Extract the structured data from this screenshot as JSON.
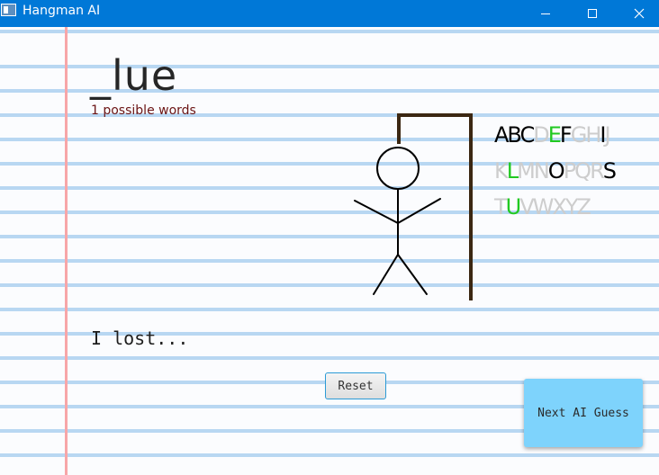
{
  "window": {
    "title": "Hangman AI",
    "controls": {
      "minimize": "—",
      "maximize": "☐",
      "close": "✕"
    }
  },
  "game": {
    "word_display": "_lue",
    "possible_words": "1 possible words",
    "status": "I lost...",
    "wrong_guesses_shown": 6
  },
  "alphabet": {
    "rows": [
      [
        {
          "ch": "A",
          "state": "used"
        },
        {
          "ch": "B",
          "state": "used"
        },
        {
          "ch": "C",
          "state": "used"
        },
        {
          "ch": "D",
          "state": "avail"
        },
        {
          "ch": "E",
          "state": "hit"
        },
        {
          "ch": "F",
          "state": "used"
        },
        {
          "ch": "G",
          "state": "avail"
        },
        {
          "ch": "H",
          "state": "avail"
        },
        {
          "ch": "I",
          "state": "used"
        },
        {
          "ch": "J",
          "state": "avail"
        }
      ],
      [
        {
          "ch": "K",
          "state": "avail"
        },
        {
          "ch": "L",
          "state": "hit"
        },
        {
          "ch": "M",
          "state": "avail"
        },
        {
          "ch": "N",
          "state": "avail"
        },
        {
          "ch": "O",
          "state": "used"
        },
        {
          "ch": "P",
          "state": "avail"
        },
        {
          "ch": "Q",
          "state": "avail"
        },
        {
          "ch": "R",
          "state": "avail"
        },
        {
          "ch": "S",
          "state": "used"
        }
      ],
      [
        {
          "ch": "T",
          "state": "avail"
        },
        {
          "ch": "U",
          "state": "hit"
        },
        {
          "ch": "V",
          "state": "avail"
        },
        {
          "ch": "W",
          "state": "avail"
        },
        {
          "ch": "X",
          "state": "avail"
        },
        {
          "ch": "Y",
          "state": "avail"
        },
        {
          "ch": "Z",
          "state": "avail"
        }
      ]
    ],
    "colors": {
      "used": "#000000",
      "hit": "#21c921",
      "avail": "#cdcdcd"
    }
  },
  "buttons": {
    "reset": "Reset",
    "next_ai_guess": "Next AI Guess"
  },
  "colors": {
    "titlebar": "#0078d7",
    "margin_line": "#f7a6a8",
    "ruled_line": "#b8d7f2",
    "gallows": "#3b2712",
    "ai_button": "#7ed3fc"
  }
}
